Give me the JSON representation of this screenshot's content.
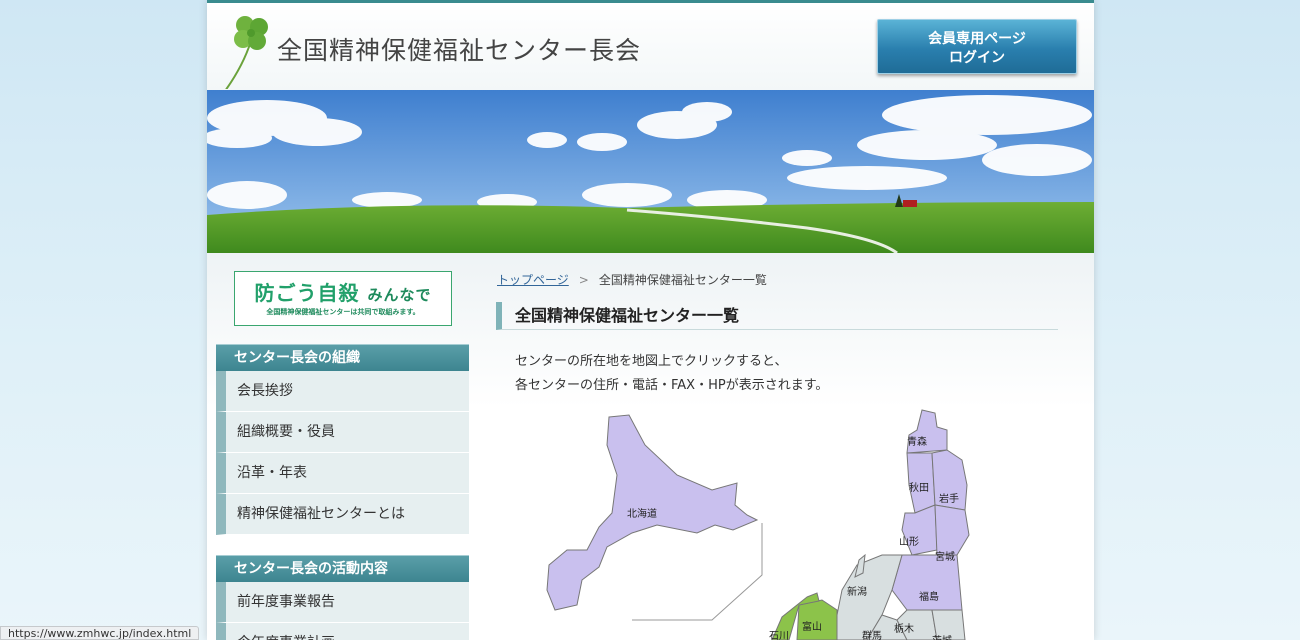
{
  "header": {
    "site_title": "全国精神保健福祉センター長会",
    "login_button": [
      "会員専用ページ",
      "ログイン"
    ]
  },
  "campaign": {
    "main": "防ごう自殺",
    "main_small": "みんなで",
    "sub": "全国精神保健福祉センターは共同で取組みます。"
  },
  "sidebar": {
    "sections": [
      {
        "title": "センター長会の組織",
        "items": [
          "会長挨拶",
          "組織概要・役員",
          "沿革・年表",
          "精神保健福祉センターとは"
        ]
      },
      {
        "title": "センター長会の活動内容",
        "items": [
          "前年度事業報告",
          "今年度事業計画"
        ]
      }
    ]
  },
  "breadcrumb": {
    "home": "トップページ",
    "separator": ">",
    "current": "全国精神保健福祉センター一覧"
  },
  "main": {
    "heading": "全国精神保健福祉センター一覧",
    "description": [
      "センターの所在地を地図上でクリックすると、",
      "各センターの住所・電話・FAX・HPが表示されます。"
    ]
  },
  "map": {
    "regions": {
      "hokkaido": "北海道",
      "aomori": "青森",
      "akita": "秋田",
      "iwate": "岩手",
      "yamagata": "山形",
      "miyagi": "宮城",
      "niigata": "新潟",
      "fukushima": "福島",
      "toyama": "富山",
      "ishikawa": "石川",
      "gunma": "群馬",
      "tochigi": "栃木",
      "ibaraki": "茨城"
    },
    "colors": {
      "tohoku_hokkaido": "#c9c0ee",
      "kanto_chubu": "#d8dfe0",
      "hokuriku": "#8cc34a"
    }
  },
  "status_bar": {
    "url": "https://www.zmhwc.jp/index.html"
  },
  "colors": {
    "accent_teal": "#3d8590",
    "login_blue": "#2a7fae",
    "campaign_green": "#21a06a"
  }
}
